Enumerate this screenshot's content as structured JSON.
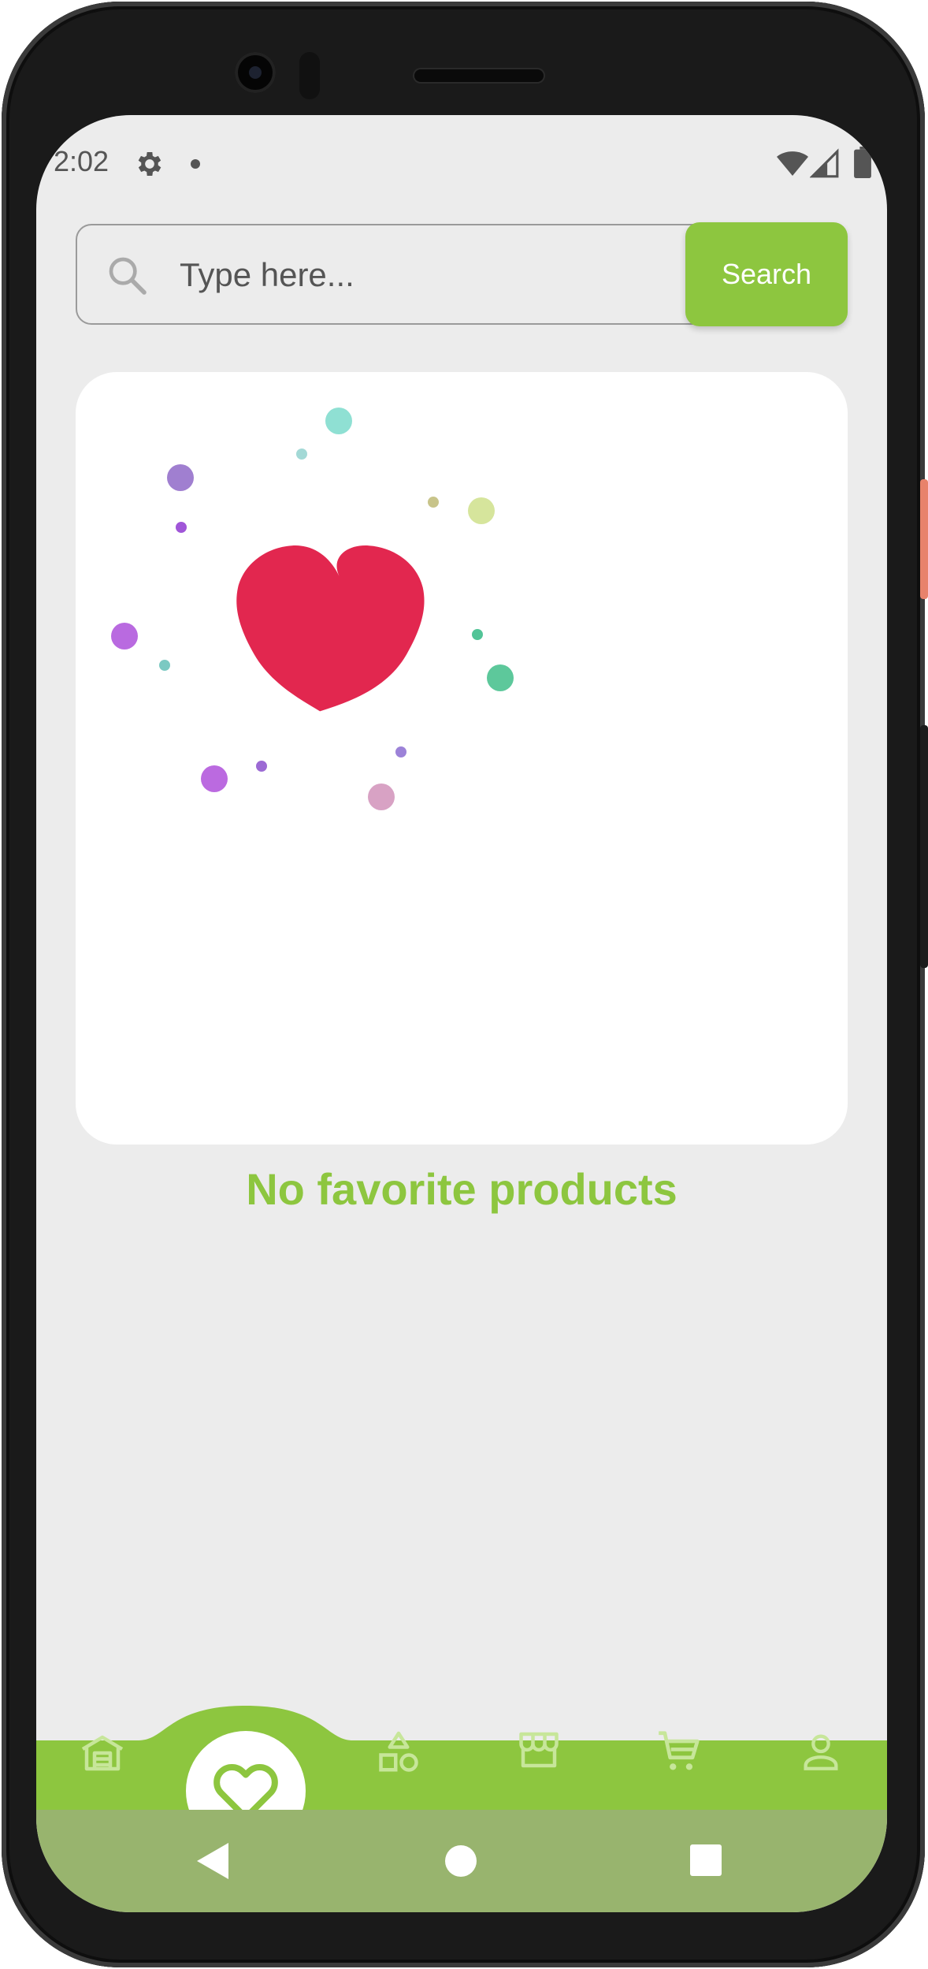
{
  "status_bar": {
    "time": "2:02",
    "icons": [
      "gear-icon",
      "notification-dot",
      "wifi-icon",
      "signal-icon",
      "battery-icon"
    ]
  },
  "search": {
    "placeholder": "Type here...",
    "button_label": "Search"
  },
  "empty_state": {
    "illustration": "heart-with-confetti",
    "message": "No favorite products"
  },
  "bottom_nav": {
    "items": [
      {
        "icon": "home-icon",
        "active": false
      },
      {
        "icon": "favorites-heart-icon",
        "active": true
      },
      {
        "icon": "categories-shapes-icon",
        "active": false
      },
      {
        "icon": "store-icon",
        "active": false
      },
      {
        "icon": "cart-icon",
        "active": false
      },
      {
        "icon": "profile-icon",
        "active": false
      }
    ]
  },
  "system_nav": {
    "icons": [
      "back-icon",
      "home-circle-icon",
      "recents-icon"
    ]
  },
  "colors": {
    "accent": "#8dc63f",
    "heart": "#e2274f",
    "background": "#ececec",
    "system_nav": "#98b46e"
  }
}
